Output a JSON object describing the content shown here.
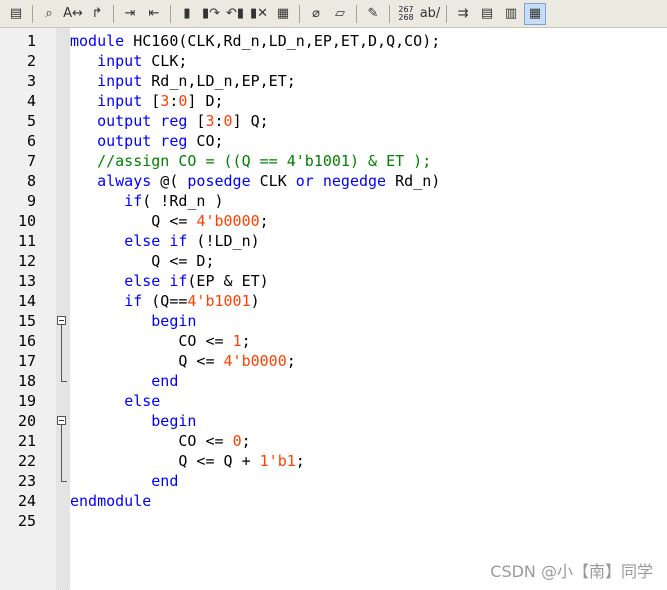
{
  "toolbar": {
    "buttons": [
      {
        "icon": "save-all-icon",
        "glyph": "▤"
      },
      {
        "icon": "find-icon",
        "glyph": "⌕"
      },
      {
        "icon": "find-replace-icon",
        "glyph": "A↔"
      },
      {
        "icon": "goto-icon",
        "glyph": "↱"
      },
      {
        "icon": "indent-icon",
        "glyph": "⇥"
      },
      {
        "icon": "outdent-icon",
        "glyph": "⇤"
      },
      {
        "icon": "bookmark-toggle-icon",
        "glyph": "▮"
      },
      {
        "icon": "bookmark-next-icon",
        "glyph": "▮↷"
      },
      {
        "icon": "bookmark-prev-icon",
        "glyph": "↶▮"
      },
      {
        "icon": "bookmark-clear-icon",
        "glyph": "▮✕"
      },
      {
        "icon": "bookmark-list-icon",
        "glyph": "▦"
      },
      {
        "icon": "attach-icon",
        "glyph": "⌀"
      },
      {
        "icon": "scroll-icon",
        "glyph": "▱"
      },
      {
        "icon": "syntax-check-icon",
        "glyph": "✎"
      },
      {
        "icon": "line-numbers-icon",
        "top": "267",
        "bottom": "268"
      },
      {
        "icon": "spell-check-icon",
        "glyph": "ab/"
      },
      {
        "icon": "word-wrap-icon",
        "glyph": "⇉"
      },
      {
        "icon": "view-normal-icon",
        "glyph": "▤"
      },
      {
        "icon": "view-split-icon",
        "glyph": "▥"
      },
      {
        "icon": "view-outline-icon",
        "glyph": "▦"
      }
    ]
  },
  "lines": [
    {
      "n": "1",
      "html": "<span class=\"kw\">module</span> HC160(CLK,Rd_n,LD_n,EP,ET,D,Q,CO);"
    },
    {
      "n": "2",
      "html": "   <span class=\"kw\">input</span> CLK;"
    },
    {
      "n": "3",
      "html": "   <span class=\"kw\">input</span> Rd_n,LD_n,EP,ET;"
    },
    {
      "n": "4",
      "html": "   <span class=\"kw\">input</span> [<span class=\"num\">3</span>:<span class=\"num\">0</span>] D;"
    },
    {
      "n": "5",
      "html": "   <span class=\"kw\">output reg</span> [<span class=\"num\">3</span>:<span class=\"num\">0</span>] Q;"
    },
    {
      "n": "6",
      "html": "   <span class=\"kw\">output reg</span> CO;"
    },
    {
      "n": "7",
      "html": "   <span class=\"cm\">//assign CO = ((Q == 4'b1001) &amp; ET );</span>"
    },
    {
      "n": "8",
      "html": "   <span class=\"kw\">always</span> @( <span class=\"kw\">posedge</span> CLK <span class=\"kw\">or</span> <span class=\"kw\">negedge</span> Rd_n)"
    },
    {
      "n": "9",
      "html": "      <span class=\"kw\">if</span>( !Rd_n )"
    },
    {
      "n": "10",
      "html": "         Q &lt;= <span class=\"num\">4'b0000</span>;"
    },
    {
      "n": "11",
      "html": "      <span class=\"kw\">else if</span> (!LD_n)"
    },
    {
      "n": "12",
      "html": "         Q &lt;= D;"
    },
    {
      "n": "13",
      "html": "      <span class=\"kw\">else if</span>(EP &amp; ET)"
    },
    {
      "n": "14",
      "html": "      <span class=\"kw\">if</span> (Q==<span class=\"num\">4'b1001</span>)"
    },
    {
      "n": "15",
      "html": "         <span class=\"kw\">begin</span>"
    },
    {
      "n": "16",
      "html": "            CO &lt;= <span class=\"num\">1</span>;"
    },
    {
      "n": "17",
      "html": "            Q &lt;= <span class=\"num\">4'b0000</span>;"
    },
    {
      "n": "18",
      "html": "         <span class=\"kw\">end</span>"
    },
    {
      "n": "19",
      "html": "      <span class=\"kw\">else</span>"
    },
    {
      "n": "20",
      "html": "         <span class=\"kw\">begin</span>"
    },
    {
      "n": "21",
      "html": "            CO &lt;= <span class=\"num\">0</span>;"
    },
    {
      "n": "22",
      "html": "            Q &lt;= Q + <span class=\"num\">1'b1</span>;"
    },
    {
      "n": "23",
      "html": "         <span class=\"kw\">end</span>"
    },
    {
      "n": "24",
      "html": "<span class=\"kw\">endmodule</span>"
    },
    {
      "n": "25",
      "html": ""
    }
  ],
  "folds": [
    {
      "start": 15,
      "end": 18
    },
    {
      "start": 20,
      "end": 23
    }
  ],
  "colors": {
    "keyword": "#0000ff",
    "number": "#ff4000",
    "comment": "#008000"
  },
  "watermark": "CSDN @小【南】同学"
}
